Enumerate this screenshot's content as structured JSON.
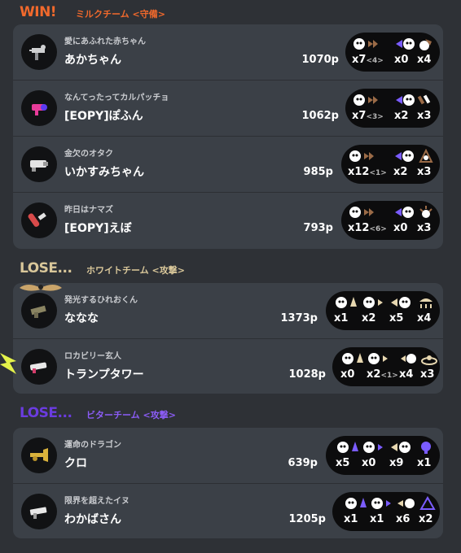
{
  "colors": {
    "win": "#f1692c",
    "lose_white": "#d9c79a",
    "lose_bitter": "#6b3ce0",
    "win_team": "#f1692c",
    "white_team": "#d9c79a",
    "bitter_team": "#8b5cf6"
  },
  "teams": [
    {
      "result": "WIN!",
      "name": "ミルクチーム <守備>",
      "players": [
        {
          "title": "愛にあふれた赤ちゃん",
          "name": "あかちゃん",
          "points": "1070p",
          "weapon_icon": "splatling-icon",
          "kills": "x7",
          "assists": "<4>",
          "specials": "x0",
          "deaths": "x4"
        },
        {
          "title": "なんてったってカルパッチョ",
          "name": "[EOPY]ぽふん",
          "points": "1062p",
          "weapon_icon": "blaster-icon",
          "kills": "x7",
          "assists": "<3>",
          "specials": "x2",
          "deaths": "x3"
        },
        {
          "title": "金欠のオタク",
          "name": "いかすみちゃん",
          "points": "985p",
          "weapon_icon": "roller-icon",
          "kills": "x12",
          "assists": "<1>",
          "specials": "x2",
          "deaths": "x3"
        },
        {
          "title": "昨日はナマズ",
          "name": "[EOPY]えぼ",
          "points": "793p",
          "weapon_icon": "brush-icon",
          "kills": "x12",
          "assists": "<6>",
          "specials": "x0",
          "deaths": "x3"
        }
      ]
    },
    {
      "result": "LOSE...",
      "name": "ホワイトチーム <攻撃>",
      "players": [
        {
          "title": "発光するひれおくん",
          "name": "ななな",
          "points": "1373p",
          "weapon_icon": "shooter-icon",
          "kills": "x1",
          "assists": "",
          "specials": "x2",
          "deaths": "x5",
          "extra": "x4"
        },
        {
          "title": "ロカビリー玄人",
          "name": "トランプタワー",
          "points": "1028p",
          "weapon_icon": "charger-icon",
          "kills": "x0",
          "assists": "<1>",
          "specials": "x2",
          "deaths": "x4",
          "extra": "x3"
        }
      ]
    },
    {
      "result": "LOSE...",
      "name": "ビターチーム <攻撃>",
      "players": [
        {
          "title": "運命のドラゴン",
          "name": "クロ",
          "points": "639p",
          "weapon_icon": "trumpet-icon",
          "kills": "x5",
          "assists": "",
          "specials": "x0",
          "deaths": "x9",
          "extra": "x1"
        },
        {
          "title": "限界を超えたイヌ",
          "name": "わかばさん",
          "points": "1205p",
          "weapon_icon": "splattershot-icon",
          "kills": "x1",
          "assists": "",
          "specials": "x1",
          "deaths": "x6",
          "extra": "x2"
        }
      ]
    }
  ]
}
